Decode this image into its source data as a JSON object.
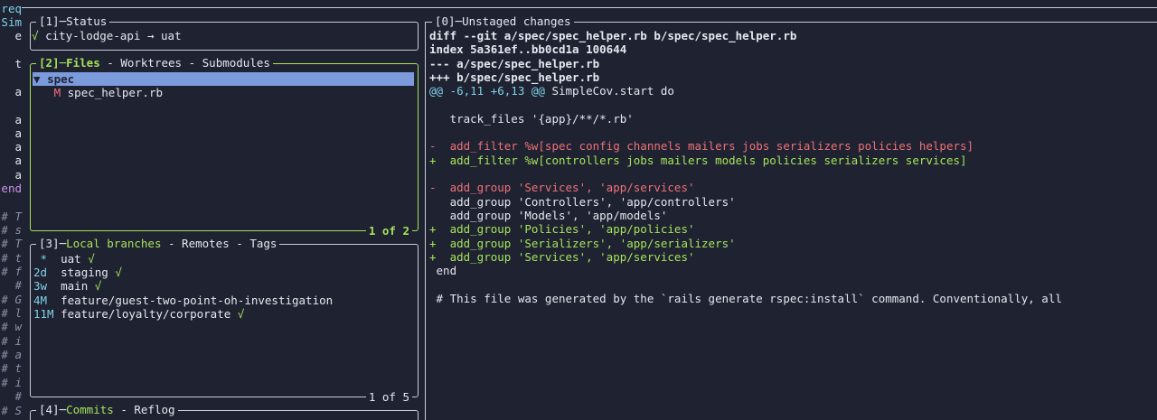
{
  "gutter": [
    "req",
    "Sim",
    "e",
    "",
    "t",
    "",
    "a",
    "",
    "a",
    "a",
    "a",
    "a",
    "a",
    "end",
    "",
    "# T",
    "# s",
    "# T",
    "# t",
    "# f",
    "#",
    "# G",
    "# l",
    "# w",
    "# i",
    "# a",
    "# t",
    "# i",
    "#",
    "# S"
  ],
  "status": {
    "title_num": "[1]",
    "title": "Status",
    "check": "√",
    "repo": "city-lodge-api",
    "arrow": "→",
    "branch": "uat"
  },
  "files": {
    "title_num": "[2]",
    "tab_active": "Files",
    "sep": " - ",
    "tab2": "Worktrees",
    "tab3": "Submodules",
    "dir_arrow": "▼",
    "dir": "spec",
    "file_status": "M",
    "file": "spec_helper.rb",
    "footer": "1 of 2"
  },
  "branches": {
    "title_num": "[3]",
    "tab_active": "Local branches",
    "tab2": "Remotes",
    "tab3": "Tags",
    "rows": [
      {
        "age": " *",
        "name": "uat",
        "mark": "√"
      },
      {
        "age": "2d",
        "name": "staging",
        "mark": "√"
      },
      {
        "age": "3w",
        "name": "main",
        "mark": "√"
      },
      {
        "age": "4M",
        "name": "feature/guest-two-point-oh-investigation",
        "mark": ""
      },
      {
        "age": "11M",
        "name": "feature/loyalty/corporate",
        "mark": "√"
      }
    ],
    "footer": "1 of 5"
  },
  "commits": {
    "title_num": "[4]",
    "tab_active": "Commits",
    "tab2": "Reflog"
  },
  "diff": {
    "title_num": "[0]",
    "title": "Unstaged changes",
    "lines": [
      {
        "kind": "header",
        "text": "diff --git a/spec/spec_helper.rb b/spec/spec_helper.rb"
      },
      {
        "kind": "header",
        "text": "index 5a361ef..bb0cd1a 100644"
      },
      {
        "kind": "header",
        "text": "--- a/spec/spec_helper.rb"
      },
      {
        "kind": "header",
        "text": "+++ b/spec/spec_helper.rb"
      },
      {
        "kind": "hunk",
        "text": "@@ -6,11 +6,13 @@",
        "rest": " SimpleCov.start do"
      },
      {
        "kind": "ctx",
        "text": ""
      },
      {
        "kind": "ctx",
        "text": "   track_files '{app}/**/*.rb'"
      },
      {
        "kind": "ctx",
        "text": ""
      },
      {
        "kind": "del",
        "text": "-  add_filter %w[spec config channels mailers jobs serializers policies helpers]"
      },
      {
        "kind": "add",
        "text": "+  add_filter %w[controllers jobs mailers models policies serializers services]"
      },
      {
        "kind": "ctx",
        "text": ""
      },
      {
        "kind": "del",
        "text": "-  add_group 'Services', 'app/services'"
      },
      {
        "kind": "ctx",
        "text": "   add_group 'Controllers', 'app/controllers'"
      },
      {
        "kind": "ctx",
        "text": "   add_group 'Models', 'app/models'"
      },
      {
        "kind": "add",
        "text": "+  add_group 'Policies', 'app/policies'"
      },
      {
        "kind": "add",
        "text": "+  add_group 'Serializers', 'app/serializers'"
      },
      {
        "kind": "add",
        "text": "+  add_group 'Services', 'app/services'"
      },
      {
        "kind": "ctx",
        "text": " end"
      },
      {
        "kind": "ctx",
        "text": ""
      },
      {
        "kind": "ctx",
        "text": " # This file was generated by the `rails generate rspec:install` command. Conventionally, all"
      }
    ]
  },
  "colors": {
    "background": "#1e2231",
    "accent_green": "#a6e35a",
    "deletion_red": "#f07178",
    "hunk_cyan": "#7fd1e8",
    "selection": "#7c9bdc"
  }
}
